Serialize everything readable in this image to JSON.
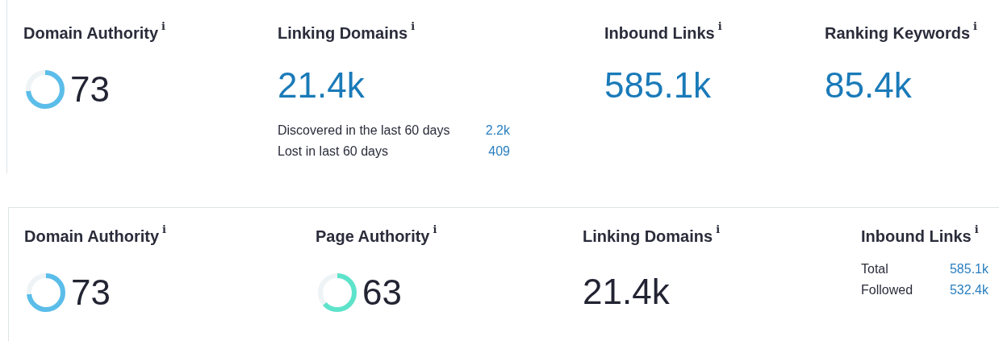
{
  "panels": [
    {
      "metrics": [
        {
          "kind": "gauge",
          "label": "Domain Authority",
          "info": "i",
          "value": "73",
          "level": 0.73,
          "color": "#5bbde9"
        },
        {
          "kind": "link_number",
          "label": "Linking Domains",
          "info": "i",
          "value": "21.4k",
          "details": [
            {
              "label": "Discovered in the last 60 days",
              "value": "2.2k"
            },
            {
              "label": "Lost in last 60 days",
              "value": "409"
            }
          ]
        },
        {
          "kind": "link_number",
          "label": "Inbound Links",
          "info": "i",
          "value": "585.1k"
        },
        {
          "kind": "link_number",
          "label": "Ranking Keywords",
          "info": "i",
          "value": "85.4k"
        }
      ]
    },
    {
      "metrics": [
        {
          "kind": "gauge",
          "label": "Domain Authority",
          "info": "i",
          "value": "73",
          "level": 0.73,
          "color": "#5bbde9"
        },
        {
          "kind": "gauge",
          "label": "Page Authority",
          "info": "i",
          "value": "63",
          "level": 0.63,
          "color": "#5ee3cb"
        },
        {
          "kind": "number",
          "label": "Linking Domains",
          "info": "i",
          "value": "21.4k"
        },
        {
          "kind": "breakdown",
          "label": "Inbound Links",
          "info": "i",
          "details": [
            {
              "label": "Total",
              "value": "585.1k"
            },
            {
              "label": "Followed",
              "value": "532.4k"
            }
          ]
        }
      ]
    }
  ]
}
